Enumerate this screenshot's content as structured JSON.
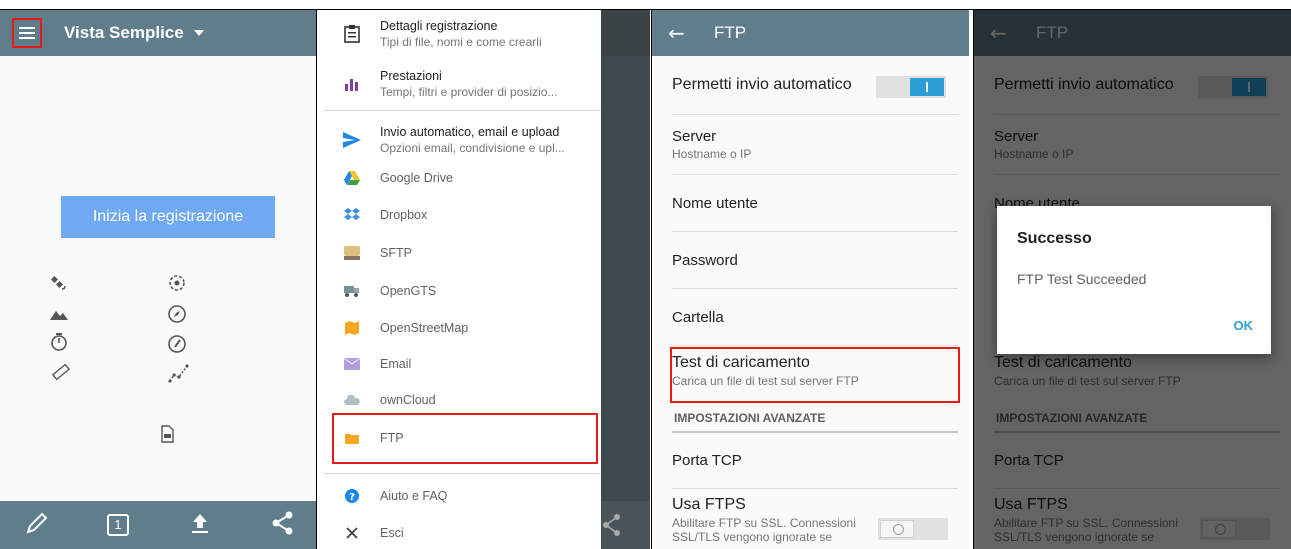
{
  "panel1": {
    "title": "Vista Semplice",
    "start_button": "Inizia la registrazione",
    "bottom_one": "1"
  },
  "drawer": {
    "items": [
      {
        "title": "Dettagli registrazione",
        "subtitle": "Tipi di file, nomi e come crearli"
      },
      {
        "title": "Prestazioni",
        "subtitle": "Tempi, filtri e provider di posizio..."
      },
      {
        "title": "Invio automatico, email e upload",
        "subtitle": "Opzioni email, condivisione e upl..."
      },
      {
        "label": "Google Drive"
      },
      {
        "label": "Dropbox"
      },
      {
        "label": "SFTP"
      },
      {
        "label": "OpenGTS"
      },
      {
        "label": "OpenStreetMap"
      },
      {
        "label": "Email"
      },
      {
        "label": "ownCloud"
      },
      {
        "label": "FTP"
      },
      {
        "label": "Aiuto e FAQ"
      },
      {
        "label": "Esci"
      }
    ]
  },
  "ftp_settings": {
    "title": "FTP",
    "auto_send": "Permetti invio automatico",
    "server": "Server",
    "server_sub": "Hostname o IP",
    "username": "Nome utente",
    "password": "Password",
    "folder": "Cartella",
    "test_upload": "Test di caricamento",
    "test_upload_sub": "Carica un file di test sul server FTP",
    "advanced_header": "IMPOSTAZIONI AVANZATE",
    "tcp_port": "Porta TCP",
    "use_ftps": "Usa FTPS",
    "use_ftps_sub": "Abilitare FTP su SSL. Connessioni SSL/TLS vengono ignorate se"
  },
  "dialog": {
    "title": "Successo",
    "message": "FTP Test Succeeded",
    "ok": "OK"
  },
  "colors": {
    "appbar": "#607d8b",
    "accent": "#2b9fd6",
    "button": "#6fa8f3",
    "highlight": "#e21b1b"
  }
}
